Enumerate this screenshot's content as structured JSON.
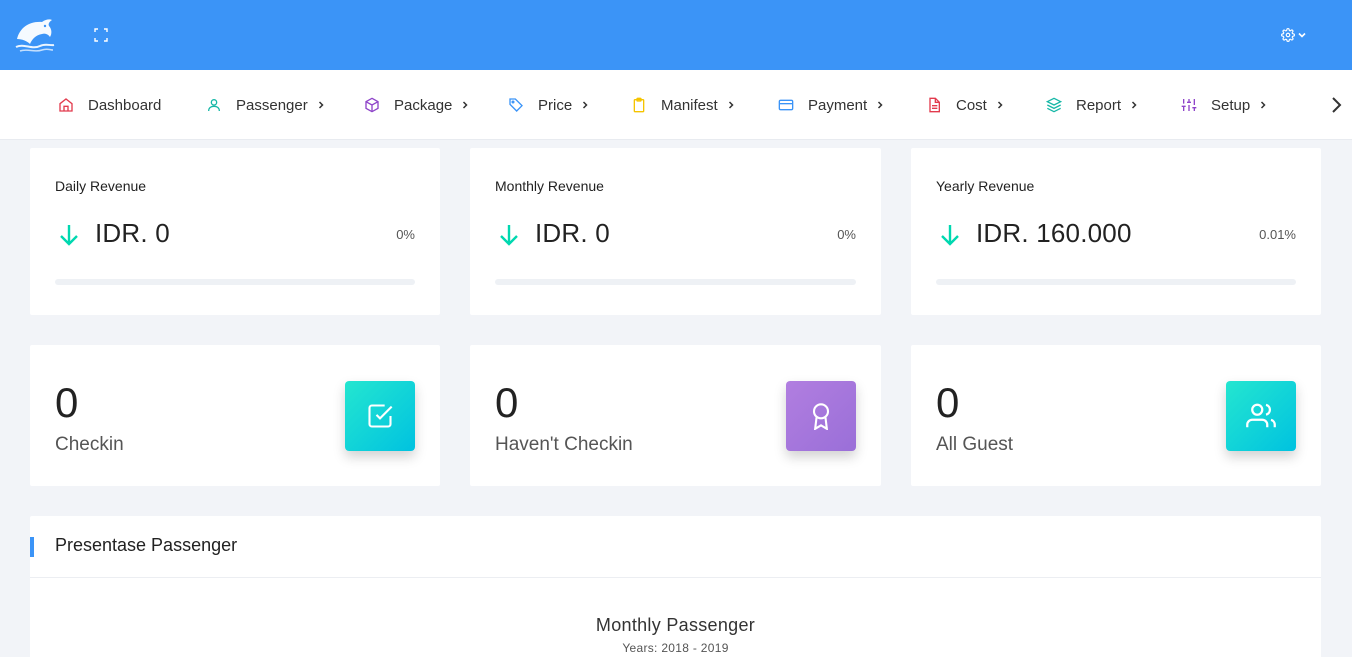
{
  "nav": {
    "items": [
      {
        "label": "Dashboard",
        "icon": "home-icon",
        "color": "#e23b4e"
      },
      {
        "label": "Passenger",
        "icon": "user-icon",
        "color": "#15b7a6"
      },
      {
        "label": "Package",
        "icon": "box-icon",
        "color": "#8e44c9"
      },
      {
        "label": "Price",
        "icon": "tag-icon",
        "color": "#3b94f7"
      },
      {
        "label": "Manifest",
        "icon": "clipboard-icon",
        "color": "#f5c400"
      },
      {
        "label": "Payment",
        "icon": "credit-card-icon",
        "color": "#3b94f7"
      },
      {
        "label": "Cost",
        "icon": "file-icon",
        "color": "#e23b4e"
      },
      {
        "label": "Report",
        "icon": "layers-icon",
        "color": "#15b7a6"
      },
      {
        "label": "Setup",
        "icon": "sliders-icon",
        "color": "#8e44c9"
      }
    ]
  },
  "revenue": [
    {
      "title": "Daily Revenue",
      "value": "IDR. 0",
      "percent": "0%",
      "progress": 0
    },
    {
      "title": "Monthly Revenue",
      "value": "IDR. 0",
      "percent": "0%",
      "progress": 0
    },
    {
      "title": "Yearly Revenue",
      "value": "IDR. 160.000",
      "percent": "0.01%",
      "progress": 0.0001
    }
  ],
  "stats": [
    {
      "count": "0",
      "label": "Checkin",
      "icon": "check-square-icon"
    },
    {
      "count": "0",
      "label": "Haven't Checkin",
      "icon": "award-icon"
    },
    {
      "count": "0",
      "label": "All Guest",
      "icon": "users-icon"
    }
  ],
  "passenger_section": {
    "title": "Presentase Passenger",
    "chart_title": "Monthly Passenger",
    "chart_subtitle": "Years: 2018 - 2019"
  },
  "colors": {
    "header": "#3b94f7",
    "accent_teal": "#00d8c4",
    "accent_purple": "#9a6fd8"
  }
}
